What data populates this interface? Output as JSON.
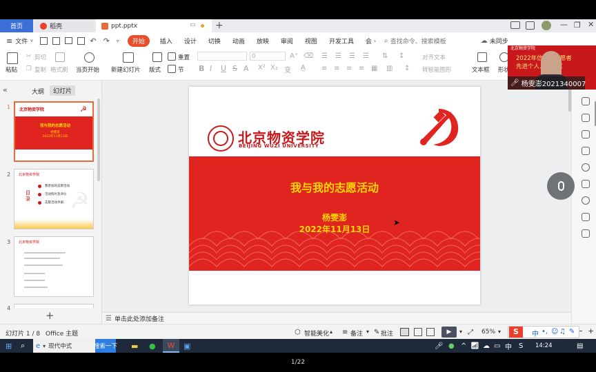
{
  "tabs": {
    "home": "首页",
    "docer": "稻壳",
    "file": "ppt.pptx"
  },
  "menu": {
    "file": "文件",
    "items": [
      "开始",
      "插入",
      "设计",
      "切换",
      "动画",
      "放映",
      "审阅",
      "视图",
      "开发工具",
      "会"
    ],
    "search": "查找命令、搜索模板",
    "sync": "未同步"
  },
  "ribbon": {
    "paste": "粘贴",
    "cut": "剪切",
    "copy": "复制",
    "format_painter": "格式刷",
    "start_from_current": "当页开始",
    "new_slide": "新建幻灯片",
    "layout": "版式",
    "section": "节",
    "reset": "重置",
    "font_size": "0",
    "align_text": "对齐文本",
    "convert_smartart": "转智能图形",
    "textbox": "文本框",
    "shape": "形状"
  },
  "left_panel": {
    "tab_outline": "大纲",
    "tab_slides": "幻灯片",
    "slide_numbers": [
      "1",
      "2",
      "3",
      "4"
    ],
    "add": "+"
  },
  "slide": {
    "university_cn": "北京物资学院",
    "university_en": "BEIJING WUZI UNIVERSITY",
    "title": "我与我的志愿活动",
    "author": "杨雯澎",
    "date": "2022年11月13日"
  },
  "thumb2": {
    "heading": "目录",
    "items": [
      "我参加的志愿活动",
      "活动照片及评价",
      "志愿活动手册"
    ]
  },
  "notes": {
    "placeholder": "单击此处添加备注"
  },
  "status": {
    "slide_pos": "幻灯片 1 / 8",
    "theme": "Office 主题",
    "smart_beautify": "智能美化",
    "notes": "备注",
    "comments": "批注",
    "zoom": "65%"
  },
  "taskbar": {
    "ime_mode": "现代中式",
    "search_btn": "搜索一下",
    "lang": "中",
    "time": "14:24"
  },
  "camera": {
    "name_label": "杨雯澎2021340007",
    "banner_line1": "2022年信...秀志愿者",
    "banner_line2": "先进个人...个人奖",
    "logo_text": "北京物资学院"
  },
  "player": {
    "page": "1/22"
  },
  "colors": {
    "accent": "#e84e2c",
    "slide_red": "#e02420",
    "title_yellow": "#ffd800",
    "tab_blue": "#3b6fd8"
  }
}
